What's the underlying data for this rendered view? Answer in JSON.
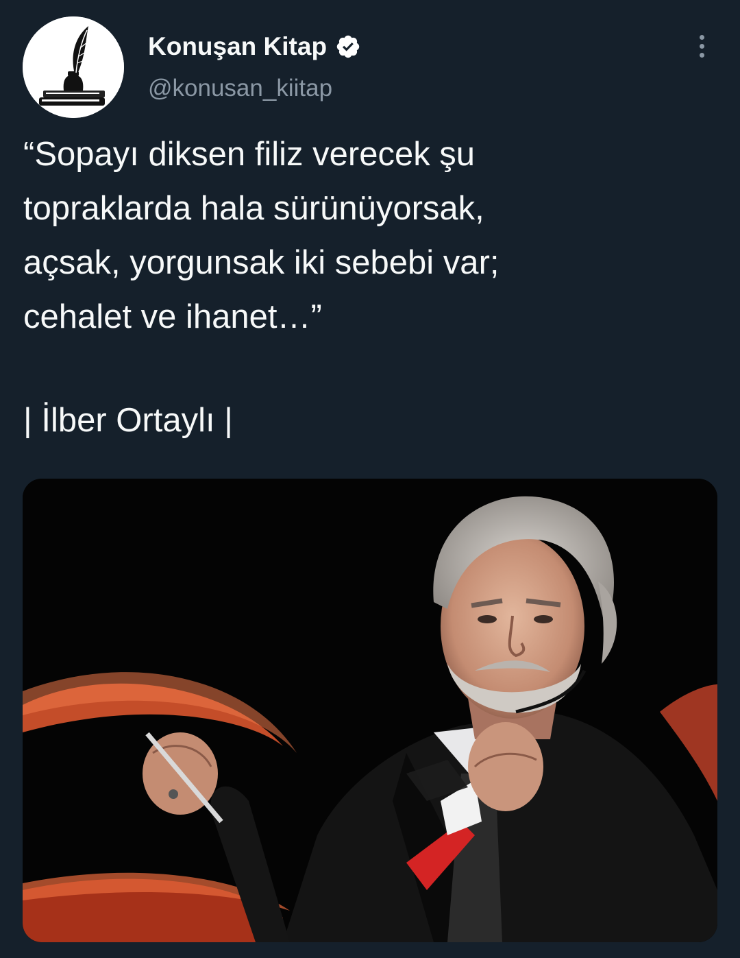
{
  "tweet": {
    "author": {
      "display_name": "Konuşan Kitap",
      "handle": "@konusan_kiitap",
      "verified": true
    },
    "text_lines": [
      "“Sopayı diksen filiz verecek şu",
      "topraklarda hala sürünüyorsak,",
      "açsak, yorgunsak iki sebebi var;",
      "cehalet ve ihanet…”"
    ],
    "attribution": "| İlber Ortaylı |",
    "media": {
      "kind": "photo",
      "icon": "photo-of-elderly-man-in-suit-holding-glasses"
    }
  },
  "theme": {
    "background": "#15202b",
    "text": "#f7f9f9",
    "secondary_text": "#8b98a5",
    "verified_badge": "#ffffff"
  }
}
